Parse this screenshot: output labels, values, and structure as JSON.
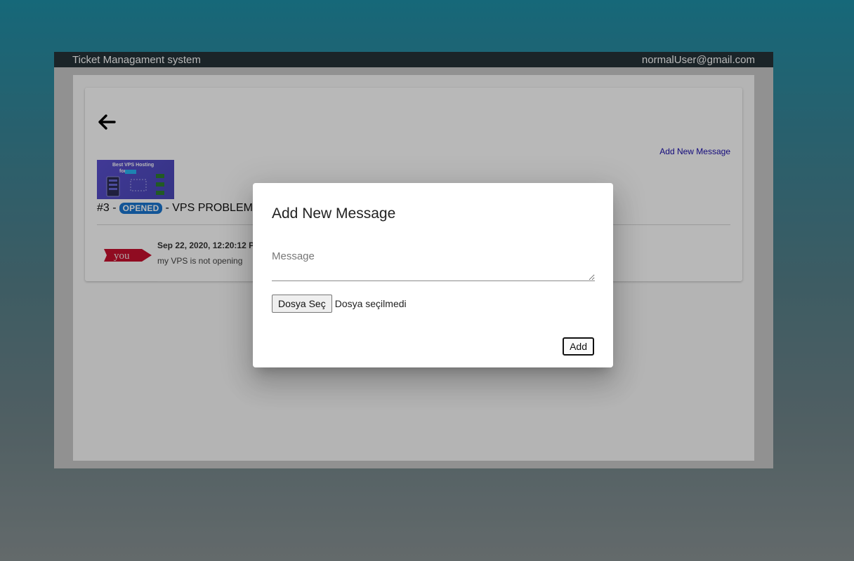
{
  "header": {
    "app_title": "Ticket Managament system",
    "user_email": "normalUser@gmail.com"
  },
  "ticket": {
    "add_message_link": "Add New Message",
    "image_text_line1": "Best VPS Hosting",
    "image_text_line2": "for",
    "number": "#3 -",
    "status": "OPENED",
    "title": "- VPS PROBLEM"
  },
  "message": {
    "avatar_text": "you",
    "date": "Sep 22, 2020, 12:20:12 P",
    "text": "my VPS is not opening"
  },
  "dialog": {
    "title": "Add New Message",
    "message_placeholder": "Message",
    "message_value": "",
    "file_button_label": "Dosya Seç",
    "file_status": "Dosya seçilmedi",
    "add_button_label": "Add"
  },
  "colors": {
    "accent_badge": "#1976d2",
    "topbar": "#263238",
    "link": "#1a0dab"
  },
  "icons": {
    "back": "arrow-left-icon"
  }
}
